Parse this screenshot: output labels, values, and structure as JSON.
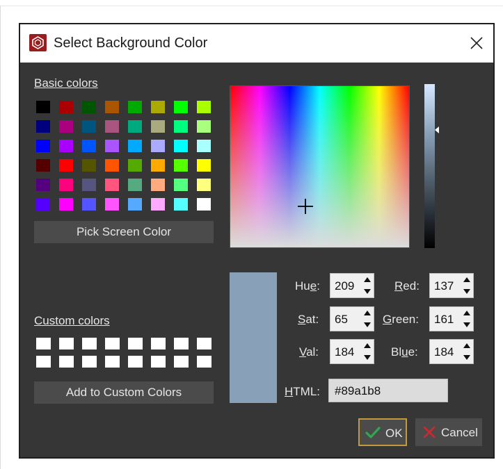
{
  "window": {
    "title": "Select Background Color"
  },
  "labels": {
    "basic_colors": "Basic colors",
    "custom_colors": "Custom colors",
    "hue": "Hue:",
    "sat": "Sat:",
    "val": "Val:",
    "red": "Red:",
    "green": "Green:",
    "blue": "Blue:",
    "html": "HTML:"
  },
  "buttons": {
    "pick_screen_color": "Pick Screen Color",
    "add_to_custom": "Add to Custom Colors",
    "ok": "OK",
    "cancel": "Cancel"
  },
  "values": {
    "hue": "209",
    "sat": "65",
    "val": "184",
    "red": "137",
    "green": "161",
    "blue": "184",
    "html": "#89a1b8"
  },
  "colors": {
    "current": "#89a1b8",
    "ok_border": "#c39a3c",
    "ok_check": "#2fa84f",
    "cancel_x": "#d2262f",
    "basic": [
      [
        "#000000",
        "#aa0000",
        "#005500",
        "#aa5500",
        "#00aa00",
        "#aaaa00",
        "#00ff00",
        "#aaff00"
      ],
      [
        "#00007f",
        "#aa007f",
        "#00557f",
        "#aa557f",
        "#00aa7f",
        "#aaaa7f",
        "#00ff7f",
        "#aaff7f"
      ],
      [
        "#0000ff",
        "#aa00ff",
        "#0055ff",
        "#aa55ff",
        "#00aaff",
        "#aaaaff",
        "#00ffff",
        "#aaffff"
      ],
      [
        "#550000",
        "#ff0000",
        "#555500",
        "#ff5500",
        "#55aa00",
        "#ffaa00",
        "#55ff00",
        "#ffff00"
      ],
      [
        "#55007f",
        "#ff007f",
        "#55557f",
        "#ff557f",
        "#55aa7f",
        "#ffaa7f",
        "#55ff7f",
        "#ffff7f"
      ],
      [
        "#5500ff",
        "#ff00ff",
        "#5555ff",
        "#ff55ff",
        "#55aaff",
        "#ffaaff",
        "#55ffff",
        "#ffffff"
      ]
    ],
    "custom": [
      [
        "#ffffff",
        "#ffffff",
        "#ffffff",
        "#ffffff",
        "#ffffff",
        "#ffffff",
        "#ffffff",
        "#ffffff"
      ],
      [
        "#ffffff",
        "#ffffff",
        "#ffffff",
        "#ffffff",
        "#ffffff",
        "#ffffff",
        "#ffffff",
        "#ffffff"
      ]
    ]
  },
  "icons": {
    "app": "app-logo-icon",
    "close": "close-icon",
    "ok": "checkmark-icon",
    "cancel": "x-icon"
  }
}
